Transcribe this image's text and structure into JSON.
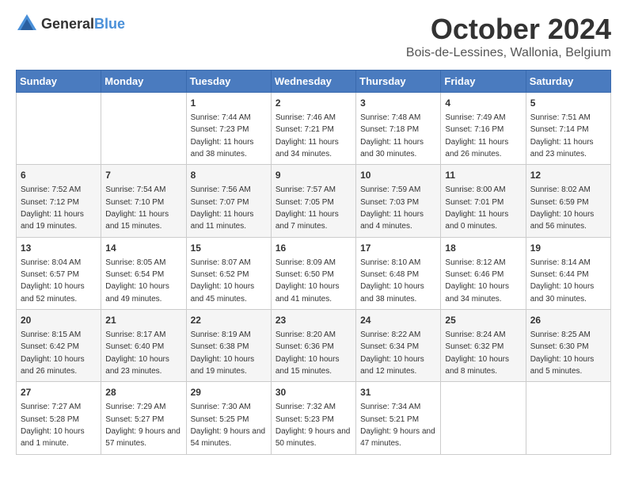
{
  "header": {
    "logo_general": "General",
    "logo_blue": "Blue",
    "month_title": "October 2024",
    "location": "Bois-de-Lessines, Wallonia, Belgium"
  },
  "weekdays": [
    "Sunday",
    "Monday",
    "Tuesday",
    "Wednesday",
    "Thursday",
    "Friday",
    "Saturday"
  ],
  "weeks": [
    [
      {
        "day": "",
        "info": ""
      },
      {
        "day": "",
        "info": ""
      },
      {
        "day": "1",
        "info": "Sunrise: 7:44 AM\nSunset: 7:23 PM\nDaylight: 11 hours and 38 minutes."
      },
      {
        "day": "2",
        "info": "Sunrise: 7:46 AM\nSunset: 7:21 PM\nDaylight: 11 hours and 34 minutes."
      },
      {
        "day": "3",
        "info": "Sunrise: 7:48 AM\nSunset: 7:18 PM\nDaylight: 11 hours and 30 minutes."
      },
      {
        "day": "4",
        "info": "Sunrise: 7:49 AM\nSunset: 7:16 PM\nDaylight: 11 hours and 26 minutes."
      },
      {
        "day": "5",
        "info": "Sunrise: 7:51 AM\nSunset: 7:14 PM\nDaylight: 11 hours and 23 minutes."
      }
    ],
    [
      {
        "day": "6",
        "info": "Sunrise: 7:52 AM\nSunset: 7:12 PM\nDaylight: 11 hours and 19 minutes."
      },
      {
        "day": "7",
        "info": "Sunrise: 7:54 AM\nSunset: 7:10 PM\nDaylight: 11 hours and 15 minutes."
      },
      {
        "day": "8",
        "info": "Sunrise: 7:56 AM\nSunset: 7:07 PM\nDaylight: 11 hours and 11 minutes."
      },
      {
        "day": "9",
        "info": "Sunrise: 7:57 AM\nSunset: 7:05 PM\nDaylight: 11 hours and 7 minutes."
      },
      {
        "day": "10",
        "info": "Sunrise: 7:59 AM\nSunset: 7:03 PM\nDaylight: 11 hours and 4 minutes."
      },
      {
        "day": "11",
        "info": "Sunrise: 8:00 AM\nSunset: 7:01 PM\nDaylight: 11 hours and 0 minutes."
      },
      {
        "day": "12",
        "info": "Sunrise: 8:02 AM\nSunset: 6:59 PM\nDaylight: 10 hours and 56 minutes."
      }
    ],
    [
      {
        "day": "13",
        "info": "Sunrise: 8:04 AM\nSunset: 6:57 PM\nDaylight: 10 hours and 52 minutes."
      },
      {
        "day": "14",
        "info": "Sunrise: 8:05 AM\nSunset: 6:54 PM\nDaylight: 10 hours and 49 minutes."
      },
      {
        "day": "15",
        "info": "Sunrise: 8:07 AM\nSunset: 6:52 PM\nDaylight: 10 hours and 45 minutes."
      },
      {
        "day": "16",
        "info": "Sunrise: 8:09 AM\nSunset: 6:50 PM\nDaylight: 10 hours and 41 minutes."
      },
      {
        "day": "17",
        "info": "Sunrise: 8:10 AM\nSunset: 6:48 PM\nDaylight: 10 hours and 38 minutes."
      },
      {
        "day": "18",
        "info": "Sunrise: 8:12 AM\nSunset: 6:46 PM\nDaylight: 10 hours and 34 minutes."
      },
      {
        "day": "19",
        "info": "Sunrise: 8:14 AM\nSunset: 6:44 PM\nDaylight: 10 hours and 30 minutes."
      }
    ],
    [
      {
        "day": "20",
        "info": "Sunrise: 8:15 AM\nSunset: 6:42 PM\nDaylight: 10 hours and 26 minutes."
      },
      {
        "day": "21",
        "info": "Sunrise: 8:17 AM\nSunset: 6:40 PM\nDaylight: 10 hours and 23 minutes."
      },
      {
        "day": "22",
        "info": "Sunrise: 8:19 AM\nSunset: 6:38 PM\nDaylight: 10 hours and 19 minutes."
      },
      {
        "day": "23",
        "info": "Sunrise: 8:20 AM\nSunset: 6:36 PM\nDaylight: 10 hours and 15 minutes."
      },
      {
        "day": "24",
        "info": "Sunrise: 8:22 AM\nSunset: 6:34 PM\nDaylight: 10 hours and 12 minutes."
      },
      {
        "day": "25",
        "info": "Sunrise: 8:24 AM\nSunset: 6:32 PM\nDaylight: 10 hours and 8 minutes."
      },
      {
        "day": "26",
        "info": "Sunrise: 8:25 AM\nSunset: 6:30 PM\nDaylight: 10 hours and 5 minutes."
      }
    ],
    [
      {
        "day": "27",
        "info": "Sunrise: 7:27 AM\nSunset: 5:28 PM\nDaylight: 10 hours and 1 minute."
      },
      {
        "day": "28",
        "info": "Sunrise: 7:29 AM\nSunset: 5:27 PM\nDaylight: 9 hours and 57 minutes."
      },
      {
        "day": "29",
        "info": "Sunrise: 7:30 AM\nSunset: 5:25 PM\nDaylight: 9 hours and 54 minutes."
      },
      {
        "day": "30",
        "info": "Sunrise: 7:32 AM\nSunset: 5:23 PM\nDaylight: 9 hours and 50 minutes."
      },
      {
        "day": "31",
        "info": "Sunrise: 7:34 AM\nSunset: 5:21 PM\nDaylight: 9 hours and 47 minutes."
      },
      {
        "day": "",
        "info": ""
      },
      {
        "day": "",
        "info": ""
      }
    ]
  ]
}
